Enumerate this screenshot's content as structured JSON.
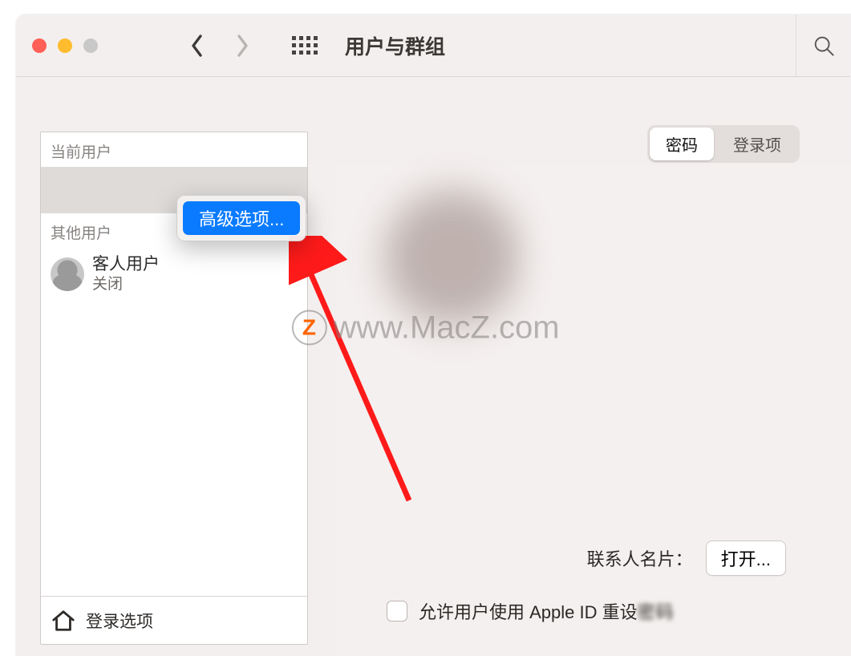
{
  "title": "用户与群组",
  "sidebar": {
    "sections": {
      "current_label": "当前用户",
      "other_label": "其他用户"
    },
    "guest": {
      "name": "客人用户",
      "status": "关闭"
    },
    "login_options_label": "登录选项"
  },
  "context_menu": {
    "advanced_label": "高级选项..."
  },
  "tabs": {
    "password": "密码",
    "login_items": "登录项"
  },
  "contact_card": {
    "label": "联系人名片：",
    "open_button": "打开..."
  },
  "reset_checkbox": {
    "label_prefix": "允许用户使用 Apple ID 重设",
    "label_blur": "密码"
  },
  "watermark": {
    "z": "Z",
    "text": "www.MacZ.com"
  }
}
